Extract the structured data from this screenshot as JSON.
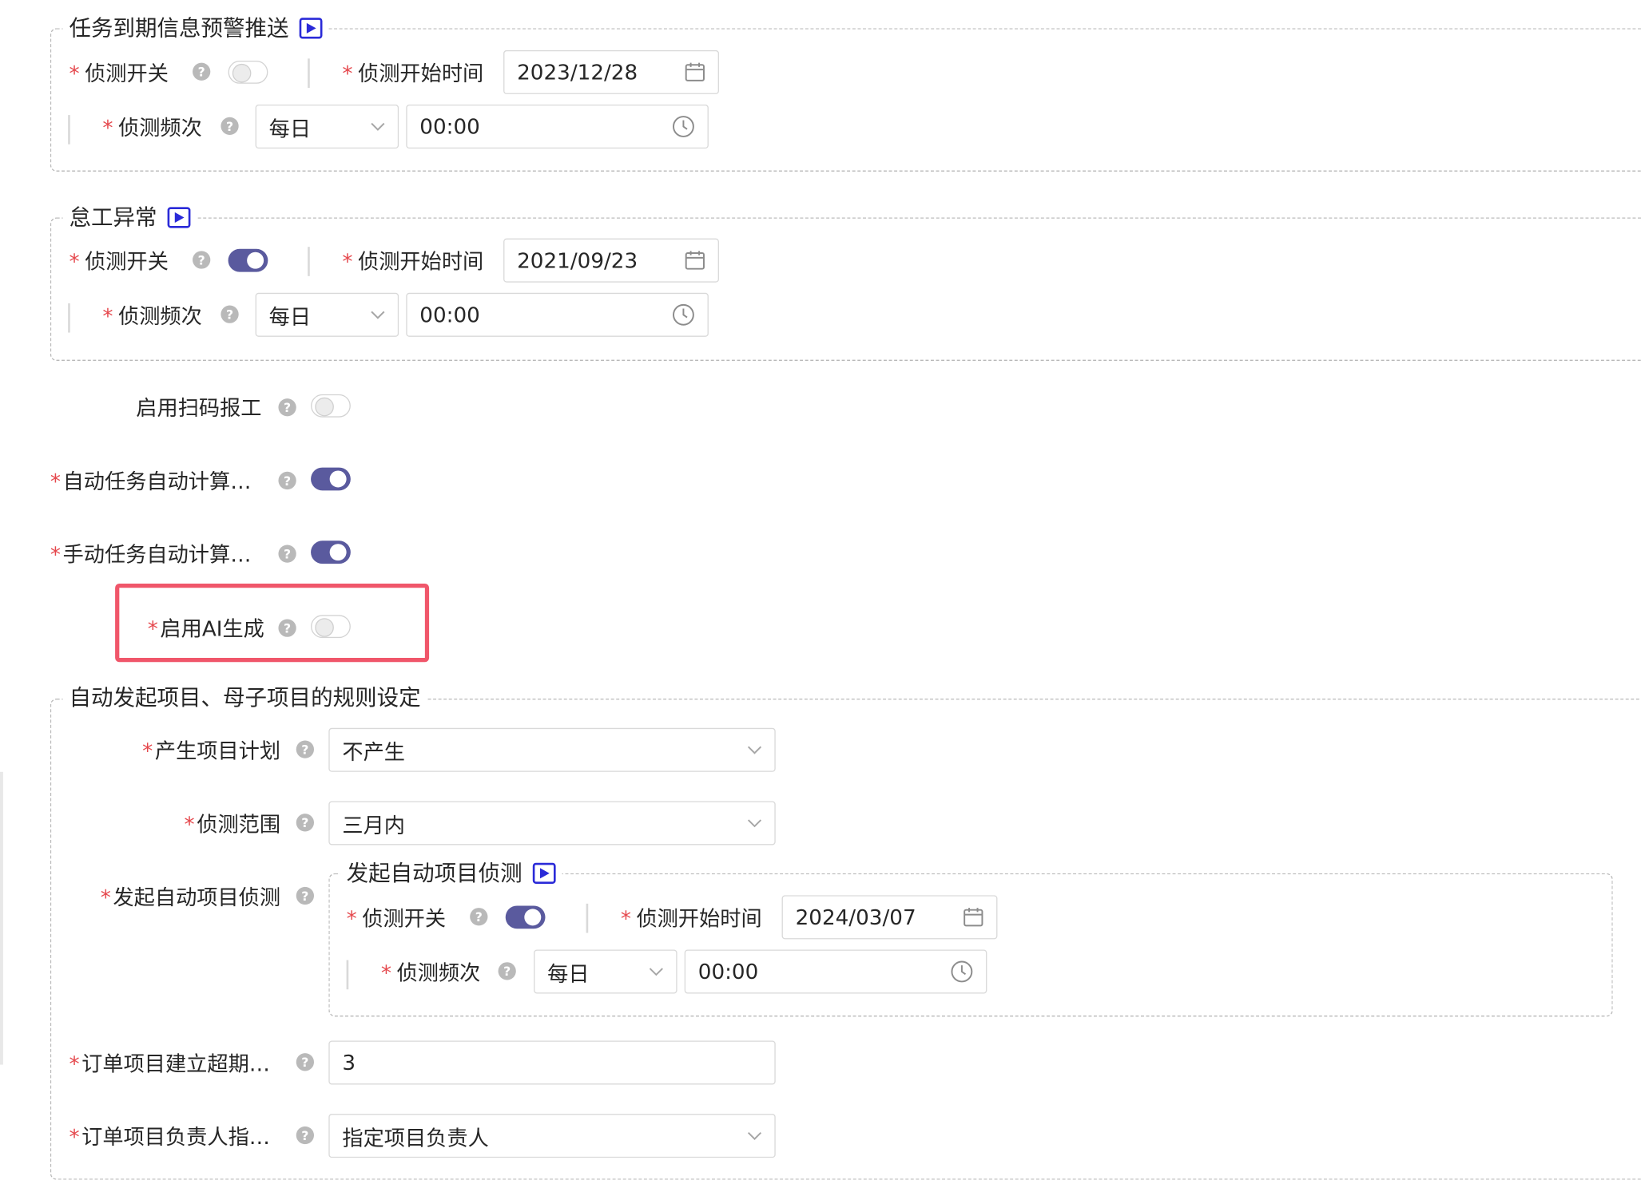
{
  "sec1": {
    "legend": "任务到期信息预警推送",
    "switch_label": "侦测开关",
    "start_label": "侦测开始时间",
    "start_value": "2023/12/28",
    "freq_label": "侦测频次",
    "freq_value": "每日",
    "time_value": "00:00",
    "switch_on": false
  },
  "sec2": {
    "legend": "怠工异常",
    "switch_label": "侦测开关",
    "start_label": "侦测开始时间",
    "start_value": "2021/09/23",
    "freq_label": "侦测频次",
    "freq_value": "每日",
    "time_value": "00:00",
    "switch_on": true
  },
  "rows": {
    "scan": {
      "label": "启用扫码报工",
      "on": false
    },
    "auto_task": {
      "label": "自动任务自动计算…",
      "on": true
    },
    "manual_task": {
      "label": "手动任务自动计算…",
      "on": true
    },
    "ai": {
      "label": "启用AI生成",
      "on": false
    }
  },
  "sec3": {
    "legend": "自动发起项目、母子项目的规则设定",
    "plan_label": "产生项目计划",
    "plan_value": "不产生",
    "range_label": "侦测范围",
    "range_value": "三月内",
    "launch_label": "发起自动项目侦测",
    "order_label": "订单项目建立超期…",
    "order_value": "3",
    "owner_label": "订单项目负责人指…",
    "owner_value": "指定项目负责人",
    "inner": {
      "legend": "发起自动项目侦测",
      "switch_label": "侦测开关",
      "start_label": "侦测开始时间",
      "start_value": "2024/03/07",
      "freq_label": "侦测频次",
      "freq_value": "每日",
      "time_value": "00:00",
      "switch_on": true
    }
  },
  "icons": {
    "help": "?",
    "play": "play-icon",
    "calendar": "calendar-icon",
    "clock": "clock-icon",
    "chevron": "chevron-down-icon"
  },
  "colors": {
    "accent": "#5a5a9e",
    "required": "#e5484d",
    "highlight": "#f0566a",
    "play_border": "#2a2ad8"
  }
}
